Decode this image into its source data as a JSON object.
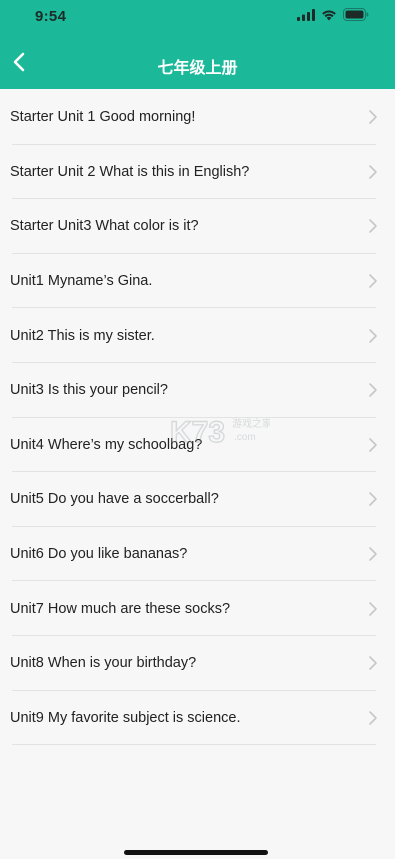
{
  "status_bar": {
    "time": "9:54",
    "icons": [
      "signal-icon",
      "wifi-icon",
      "battery-icon"
    ]
  },
  "nav": {
    "title": "七年级上册",
    "back_icon": "chevron-left-icon"
  },
  "colors": {
    "header_bg": "#1bb99a",
    "page_bg": "#f7f7f7",
    "text": "#222222",
    "chevron": "#c7c7c7",
    "divider": "#e3e3e3"
  },
  "list": {
    "items": [
      {
        "label": "Starter Unit 1 Good morning!"
      },
      {
        "label": "Starter Unit 2 What is this in English?"
      },
      {
        "label": "Starter Unit3 What color is it?"
      },
      {
        "label": "Unit1 Myname’s Gina."
      },
      {
        "label": "Unit2 This is my sister."
      },
      {
        "label": "Unit3 Is this your pencil?"
      },
      {
        "label": "Unit4 Where’s my schoolbag?"
      },
      {
        "label": "Unit5 Do you have a soccerball?"
      },
      {
        "label": "Unit6 Do you like bananas?"
      },
      {
        "label": "Unit7 How much are these socks?"
      },
      {
        "label": "Unit8 When is your birthday?"
      },
      {
        "label": "Unit9 My favorite subject is science."
      }
    ],
    "item_icon": "chevron-right-icon"
  },
  "watermark": {
    "brand": "K73",
    "text_cn": "游戏之家",
    "text_url": ".com"
  }
}
